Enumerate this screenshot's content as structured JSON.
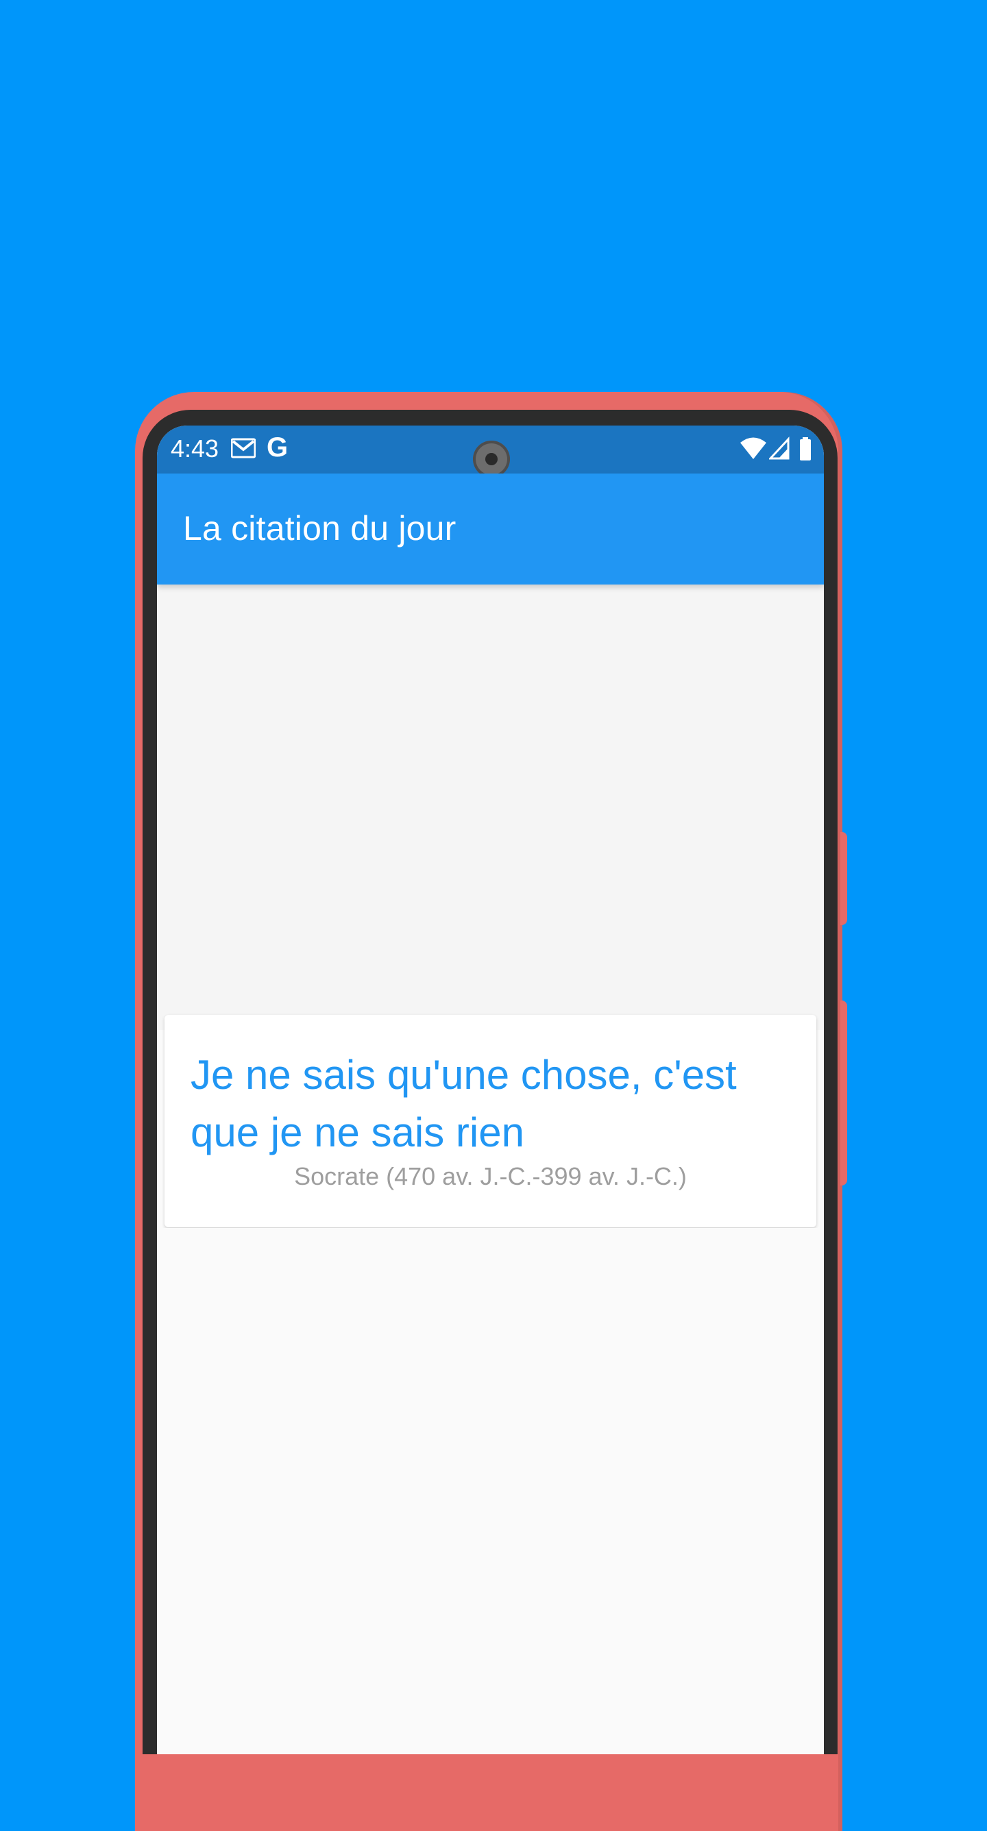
{
  "status_bar": {
    "time": "4:43",
    "google_label": "G",
    "icons": [
      "gmail-icon",
      "google-icon",
      "wifi-icon",
      "signal-icon",
      "battery-icon"
    ]
  },
  "app_bar": {
    "title": "La citation du jour"
  },
  "quote": {
    "text": "Je ne sais qu'une chose, c'est que je ne sais rien",
    "author": "Socrate (470 av. J.-C.-399 av. J.-C.)"
  },
  "colors": {
    "background": "#0096fa",
    "phone_frame": "#e66a67",
    "status_bar": "#1b75c1",
    "app_bar": "#2196f3",
    "quote_text": "#2196f3",
    "author_text": "#9e9e9e"
  }
}
